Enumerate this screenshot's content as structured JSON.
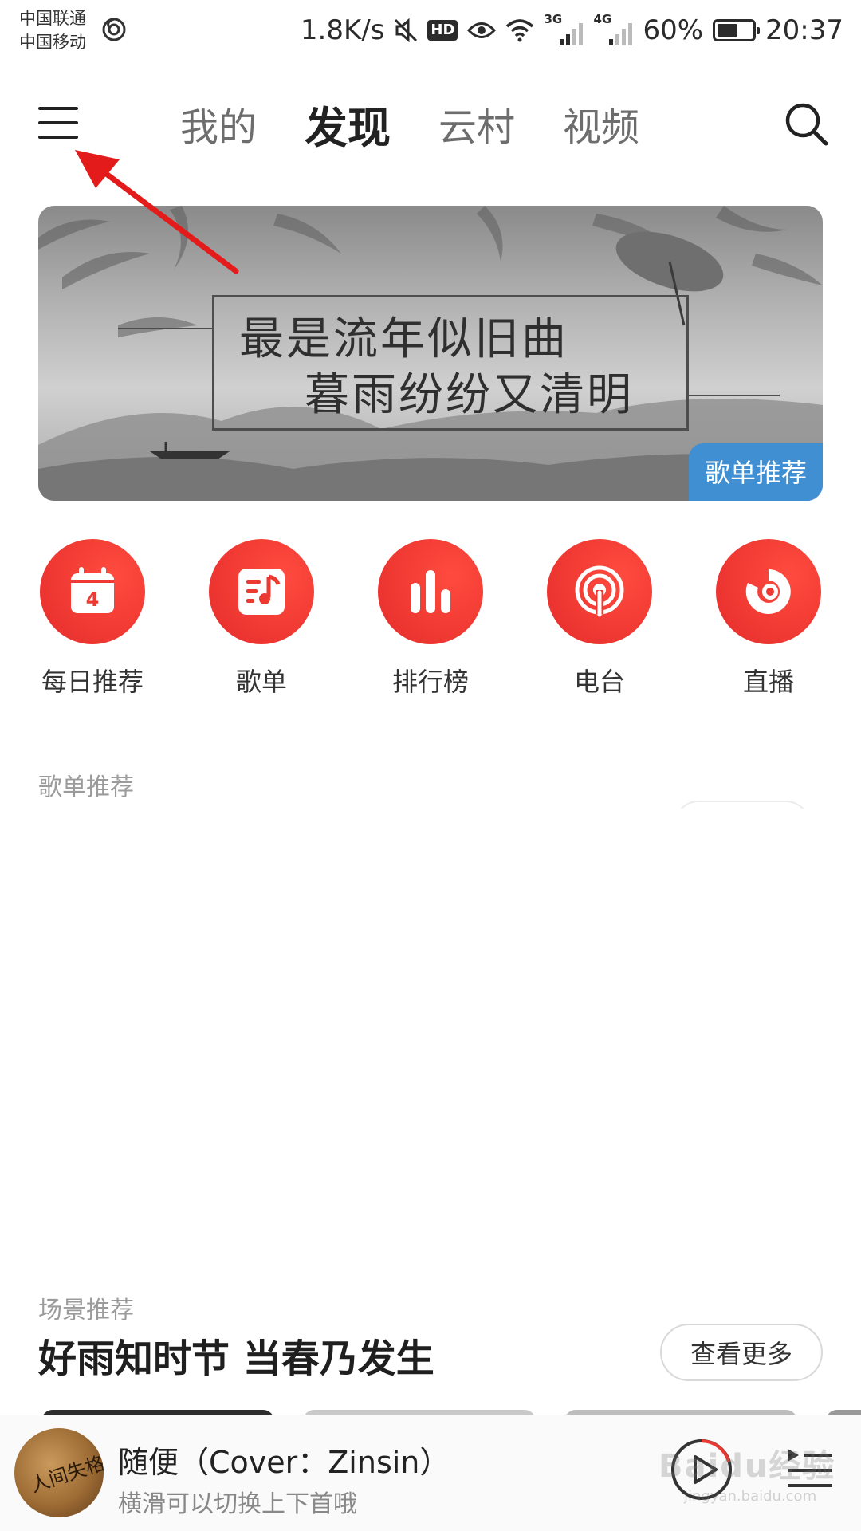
{
  "status_bar": {
    "carrier1": "中国联通",
    "carrier2": "中国移动",
    "speed": "1.8K/s",
    "hd": "HD",
    "net1": "3G",
    "net2": "4G",
    "battery": "60%",
    "battery_level": 0.6,
    "time": "20:37"
  },
  "nav": {
    "tabs": [
      {
        "label": "我的",
        "active": false
      },
      {
        "label": "发现",
        "active": true
      },
      {
        "label": "云村",
        "active": false
      },
      {
        "label": "视频",
        "active": false
      }
    ]
  },
  "banner": {
    "line1": "最是流年似旧曲",
    "line2": "暮雨纷纷又清明",
    "badge": "歌单推荐"
  },
  "quick_entries": [
    {
      "label": "每日推荐",
      "icon": "calendar-icon",
      "day": "4"
    },
    {
      "label": "歌单",
      "icon": "playlist-icon"
    },
    {
      "label": "排行榜",
      "icon": "chart-bars-icon"
    },
    {
      "label": "电台",
      "icon": "radio-icon"
    },
    {
      "label": "直播",
      "icon": "live-icon"
    }
  ],
  "playlist_section": {
    "subtitle": "歌单推荐"
  },
  "scene_section": {
    "subtitle": "场景推荐",
    "title": "好雨知时节 当春乃发生",
    "more": "查看更多"
  },
  "player": {
    "cover_text": "人间失格",
    "title": "随便（Cover：Zinsin）",
    "subtitle": "横滑可以切换上下首哦"
  },
  "watermark": {
    "text": "Baidu经验",
    "sub": "jingyan.baidu.com"
  },
  "colors": {
    "accent_red": "#ec3a33",
    "badge_blue": "#3f8fd2",
    "annotation_red": "#e31b1b"
  }
}
